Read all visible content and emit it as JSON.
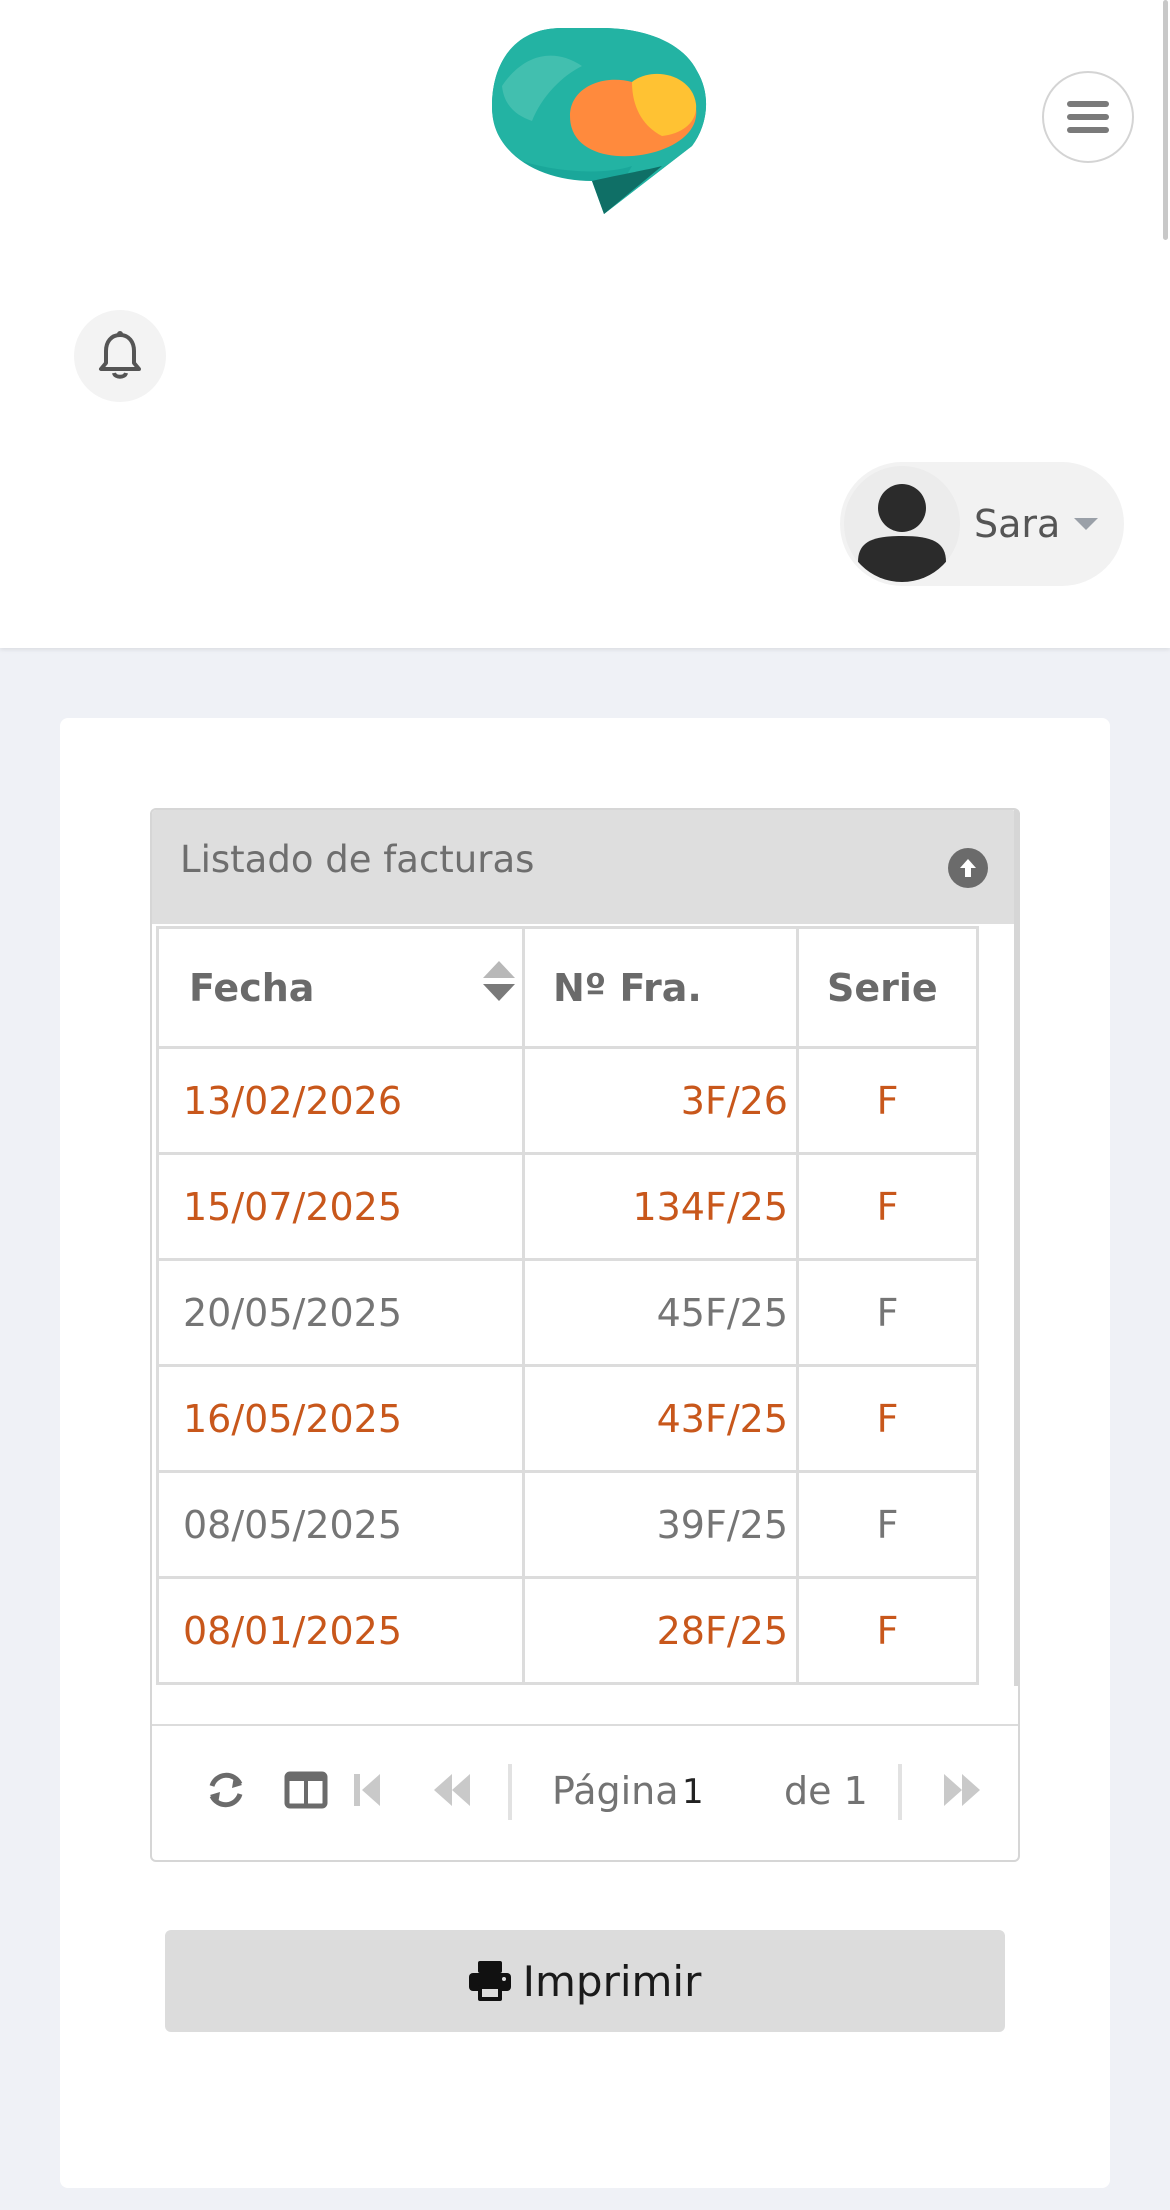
{
  "header": {
    "user_name": "Sara"
  },
  "invoices_grid": {
    "title": "Listado de facturas",
    "columns": [
      "Fecha",
      "Nº Fra.",
      "Serie"
    ],
    "rows": [
      {
        "fecha": "13/02/2026",
        "numero": "3F/26",
        "serie": "F",
        "highlighted": true
      },
      {
        "fecha": "15/07/2025",
        "numero": "134F/25",
        "serie": "F",
        "highlighted": true
      },
      {
        "fecha": "20/05/2025",
        "numero": "45F/25",
        "serie": "F",
        "highlighted": false
      },
      {
        "fecha": "16/05/2025",
        "numero": "43F/25",
        "serie": "F",
        "highlighted": true
      },
      {
        "fecha": "08/05/2025",
        "numero": "39F/25",
        "serie": "F",
        "highlighted": false
      },
      {
        "fecha": "08/01/2025",
        "numero": "28F/25",
        "serie": "F",
        "highlighted": true
      }
    ],
    "pager": {
      "page_label": "Página",
      "page_value": "1",
      "of_label": "de 1"
    },
    "highlight_color": "#c8571b"
  },
  "actions": {
    "print_label": "Imprimir"
  },
  "icons": [
    "logo",
    "hamburger-icon",
    "bell-icon",
    "user-avatar-icon",
    "chevron-down-icon",
    "collapse-up-icon",
    "sort-icon",
    "refresh-icon",
    "columns-icon",
    "first-page-icon",
    "prev-page-icon",
    "next-page-icon",
    "print-icon"
  ]
}
